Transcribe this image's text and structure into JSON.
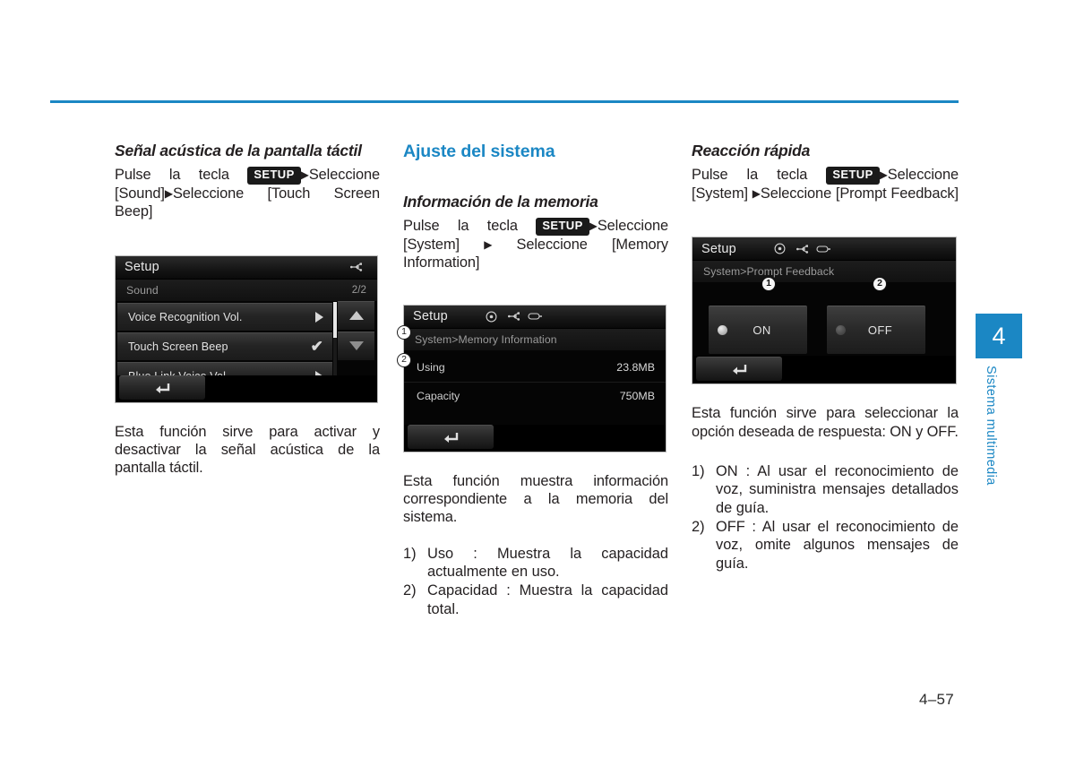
{
  "page": {
    "number": "4–57",
    "chapter_tab": "4",
    "chapter_label": "Sistema multimedia",
    "accent_color": "#1b87c4"
  },
  "columns": {
    "left": {
      "sub_heading": "Señal acústica de la pantalla táctil",
      "path": {
        "prefix": "Pulse la tecla",
        "key": "SETUP",
        "arrow": "▶",
        "rest_1": "Seleccione [Sound]",
        "rest_2": "Seleccione [Touch Screen Beep]"
      },
      "description": "Esta función sirve para activar y desactivar la señal acústica de la pantalla táctil.",
      "screen": {
        "title": "Setup",
        "breadcrumb": "Sound",
        "page_indicator": "2/2",
        "icons": [
          "usb-icon"
        ],
        "rows": [
          {
            "label": "Voice Recognition Vol.",
            "control": "arrow"
          },
          {
            "label": "Touch Screen Beep",
            "control": "check"
          },
          {
            "label": "Blue Link Voice Vol.",
            "control": "arrow"
          }
        ],
        "scroll_up": "▲",
        "scroll_down": "▼",
        "back_button": "back-arrow-icon"
      }
    },
    "middle": {
      "section_heading": "Ajuste del sistema",
      "sub_heading": "Información de la memoria",
      "path": {
        "prefix": "Pulse la tecla",
        "key": "SETUP",
        "arrow": "▶",
        "rest_1": "Seleccione [System]",
        "rest_2": "Seleccione [Memory Information]"
      },
      "description": "Esta función muestra información correspondiente a la memoria del sistema.",
      "list": [
        {
          "marker": "1)",
          "text": "Uso : Muestra la capacidad actualmente en uso."
        },
        {
          "marker": "2)",
          "text": "Capacidad : Muestra la capacidad total."
        }
      ],
      "screen": {
        "title": "Setup",
        "breadcrumb": "System>Memory Information",
        "icons": [
          "disc-icon",
          "usb-icon",
          "aux-icon"
        ],
        "rows": [
          {
            "callout": "1",
            "label": "Using",
            "value": "23.8MB"
          },
          {
            "callout": "2",
            "label": "Capacity",
            "value": "750MB"
          }
        ],
        "back_button": "back-arrow-icon"
      }
    },
    "right": {
      "sub_heading": "Reacción rápida",
      "path": {
        "prefix": "Pulse la tecla",
        "key": "SETUP",
        "arrow": "▶",
        "rest_1": "Seleccione [System]",
        "rest_2": "Seleccione [Prompt Feedback]"
      },
      "description": "Esta función sirve para seleccionar la opción deseada de respuesta: ON y OFF.",
      "list": [
        {
          "marker": "1)",
          "text": "ON : Al usar el reconocimiento de voz, suministra mensajes detallados de guía."
        },
        {
          "marker": "2)",
          "text": "OFF : Al usar el reconocimiento de voz, omite algunos mensajes de guía."
        }
      ],
      "screen": {
        "title": "Setup",
        "breadcrumb": "System>Prompt Feedback",
        "icons": [
          "disc-icon",
          "usb-icon",
          "aux-icon"
        ],
        "options": [
          {
            "callout": "1",
            "label": "ON",
            "selected": true
          },
          {
            "callout": "2",
            "label": "OFF",
            "selected": false
          }
        ],
        "back_button": "back-arrow-icon"
      }
    }
  }
}
